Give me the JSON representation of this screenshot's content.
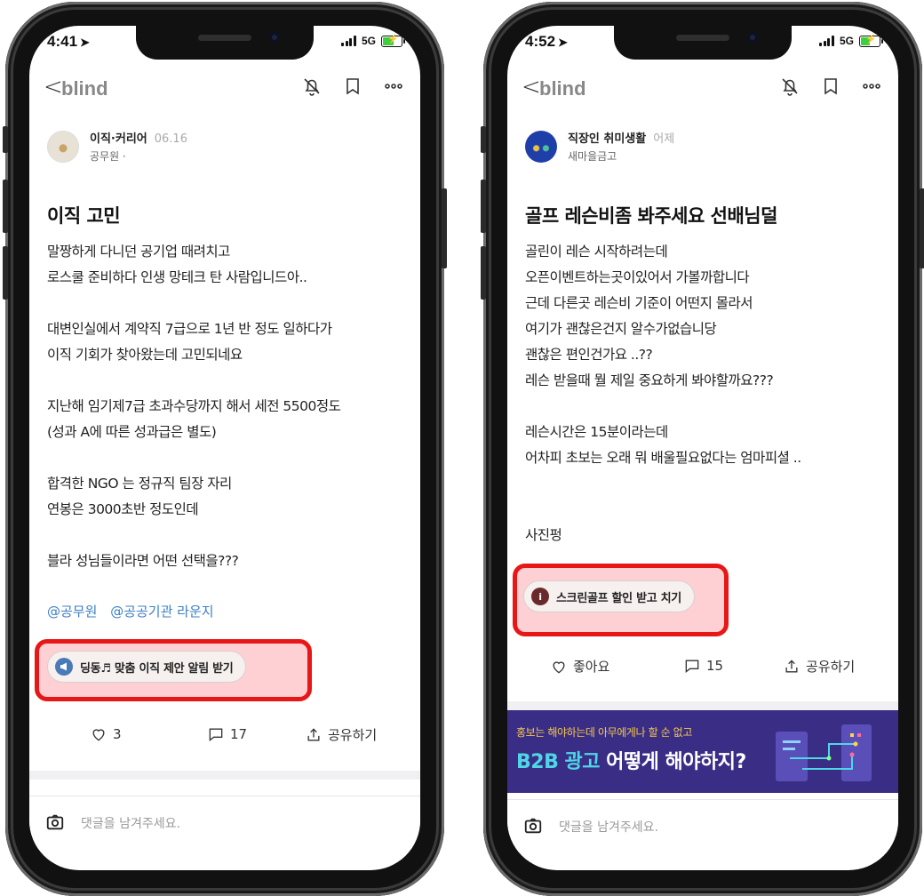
{
  "phones": [
    {
      "status": {
        "time": "4:41",
        "network": "5G"
      },
      "nav": {
        "back": "<",
        "brand": "blind"
      },
      "author": {
        "board": "이직·커리어",
        "date": "06.16",
        "company": "공무원 ·"
      },
      "title": "이직 고민",
      "body": [
        "말짱하게 다니던 공기업 때려치고",
        "로스쿨 준비하다 인생 망테크 탄 사람입니드아..",
        "",
        "대변인실에서 계약직 7급으로 1년 반 정도 일하다가",
        "이직 기회가 찾아왔는데 고민되네요",
        "",
        "지난해 임기제7급 초과수당까지 해서 세전 5500정도",
        "(성과 A에 따른 성과급은 별도)",
        "",
        "합격한 NGO 는 정규직 팀장 자리",
        "연봉은 3000초반 정도인데",
        "",
        "블라 성님들이라면 어떤 선택을???"
      ],
      "tags": [
        "@공무원",
        "@공공기관 라운지"
      ],
      "promo": {
        "label": "딩동♬ 맞춤 이직 제안 알림 받기",
        "icon": "megaphone-icon",
        "icon_color": "#4a79b8"
      },
      "actions": {
        "likes": "3",
        "comments": "17",
        "share": "공유하기"
      },
      "comment_placeholder": "댓글을 남겨주세요."
    },
    {
      "status": {
        "time": "4:52",
        "network": "5G"
      },
      "nav": {
        "back": "<",
        "brand": "blind"
      },
      "author": {
        "board": "직장인 취미생활",
        "date": "어제",
        "company": "새마을금고"
      },
      "title": "골프 레슨비좀 봐주세요 선배님덜",
      "body": [
        "골린이 레슨 시작하려는데",
        "오픈이벤트하는곳이있어서 가볼까합니다",
        "근데 다른곳 레슨비 기준이 어떤지 몰라서",
        "여기가 괜찮은건지 알수가없습니당",
        "괜찮은 편인건가요 ..??",
        "레슨 받을때 뭘 제일 중요하게 봐야할까요???",
        "",
        "레슨시간은 15분이라는데",
        "어차피 초보는 오래 뭐 배울필요없다는 엄마피셜 ..",
        "",
        "",
        "사진펑"
      ],
      "promo": {
        "label": "스크린골프 할인 받고 치기",
        "icon": "info-icon",
        "icon_color": "#6b2a2a"
      },
      "actions": {
        "likes": "좋아요",
        "comments": "15",
        "share": "공유하기"
      },
      "ad": {
        "small": "홍보는 해야하는데 아무에게나 할 순 없고",
        "big_highlight": "B2B 광고",
        "big_rest": " 어떻게 해야하지?"
      },
      "comment_placeholder": "댓글을 남겨주세요."
    }
  ]
}
